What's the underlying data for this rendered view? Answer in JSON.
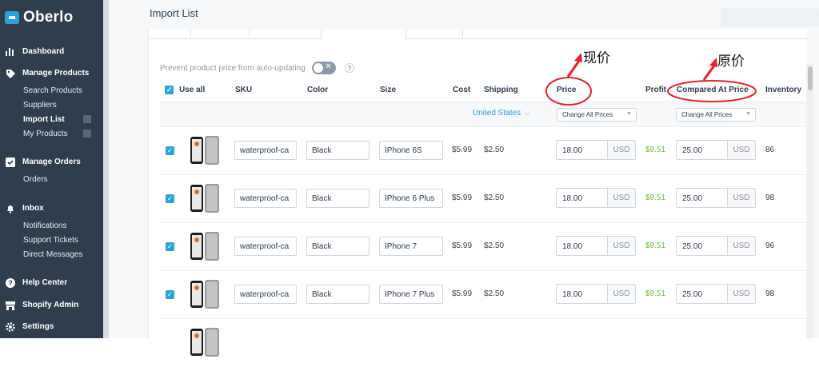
{
  "sidebar": {
    "brand": "Oberlo",
    "sections": [
      {
        "label": "Dashboard",
        "icon": "bar-chart-icon"
      },
      {
        "label": "Manage Products",
        "icon": "tag-icon",
        "items": [
          "Search Products",
          "Suppliers",
          "Import List",
          "My Products"
        ]
      },
      {
        "label": "Manage Orders",
        "icon": "check-square-icon",
        "items": [
          "Orders"
        ]
      },
      {
        "label": "Inbox",
        "icon": "bell-icon",
        "items": [
          "Notifications",
          "Support Tickets",
          "Direct Messages"
        ]
      },
      {
        "label": "Help Center",
        "icon": "help-icon"
      },
      {
        "label": "Shopify Admin",
        "icon": "store-icon"
      },
      {
        "label": "Settings",
        "icon": "gear-icon"
      }
    ],
    "active_item": "Import List"
  },
  "header": {
    "title": "Import List"
  },
  "controls": {
    "prevent_label": "Prevent product price from auto-updating",
    "toggle_on": false
  },
  "table": {
    "headers": {
      "use_all": "Use all",
      "sku": "SKU",
      "color": "Color",
      "size": "Size",
      "cost": "Cost",
      "shipping": "Shipping",
      "price": "Price",
      "profit": "Profit",
      "compared": "Compared At Price",
      "inventory": "Inventory"
    },
    "shipping_country": "United States",
    "change_all": "Change All Prices",
    "currency": "USD",
    "rows": [
      {
        "sku": "waterproof-ca",
        "color": "Black",
        "size": "IPhone 6S",
        "cost": "$5.99",
        "shipping": "$2.50",
        "price": "18.00",
        "profit": "$9.51",
        "compared": "25.00",
        "inventory": "86"
      },
      {
        "sku": "waterproof-ca",
        "color": "Black",
        "size": "IPhone 6 Plus",
        "cost": "$5.99",
        "shipping": "$2.50",
        "price": "18.00",
        "profit": "$9.51",
        "compared": "25.00",
        "inventory": "98"
      },
      {
        "sku": "waterproof-ca",
        "color": "Black",
        "size": "IPhone 7",
        "cost": "$5.99",
        "shipping": "$2.50",
        "price": "18.00",
        "profit": "$9.51",
        "compared": "25.00",
        "inventory": "96"
      },
      {
        "sku": "waterproof-ca",
        "color": "Black",
        "size": "IPhone 7 Plus",
        "cost": "$5.99",
        "shipping": "$2.50",
        "price": "18.00",
        "profit": "$9.51",
        "compared": "25.00",
        "inventory": "98"
      }
    ]
  },
  "annotations": {
    "current_price": "现价",
    "original_price": "原价",
    "color": "#e8202a"
  }
}
